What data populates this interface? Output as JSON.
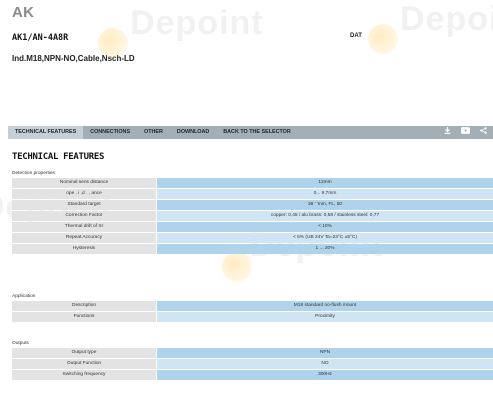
{
  "header": {
    "brand": "AK",
    "code": "AK1/AN-4A8R",
    "description": "Ind.M18,NPN-NO,Cable,Nsch-LD",
    "datasheet_label": "DAT"
  },
  "watermark": {
    "text": "Depoint"
  },
  "navbar": {
    "tabs": [
      {
        "label": "TECHNICAL FEATURES",
        "active": true
      },
      {
        "label": "CONNECTIONS"
      },
      {
        "label": "OTHER"
      },
      {
        "label": "DOWNLOAD"
      },
      {
        "label": "BACK TO THE SELECTOR"
      }
    ],
    "icons": [
      "download-icon",
      "youtube-icon",
      "share-icon"
    ]
  },
  "section_title": "TECHNICAL FEATURES",
  "groups": [
    {
      "label": "Detection properties",
      "rows": [
        {
          "label": "Nominal sens    distance",
          "value": "12mm"
        },
        {
          "label": "  ope   . i   ,d   . , ance",
          "value": "0... 9,7mm"
        },
        {
          "label": "Standard target",
          "value": "36  ' 'mm,  FL, 50"
        },
        {
          "label": "Correction Factor",
          "value": "copper: 0,45 / alu        brass: 0,58 / stainless steel: 0,77"
        },
        {
          "label": "Thermal drift of Sr",
          "value": "< 10%"
        },
        {
          "label": "Repeat Accuracy",
          "value": "< 5% (UB 24V Ta=23°C ±5°C)"
        },
        {
          "label": "Hysteresis",
          "value": "1 ... 20%"
        }
      ]
    },
    {
      "label": "Application",
      "rows": [
        {
          "label": "Description",
          "value": "M18 standard no-flush mount"
        },
        {
          "label": "Functions",
          "value": "Proximity"
        }
      ]
    },
    {
      "label": "Outputs",
      "rows": [
        {
          "label": "Output type",
          "value": "NPN"
        },
        {
          "label": "Output Function",
          "value": "NO"
        },
        {
          "label": "Switching frequency",
          "value": "300Hz"
        }
      ]
    }
  ]
}
